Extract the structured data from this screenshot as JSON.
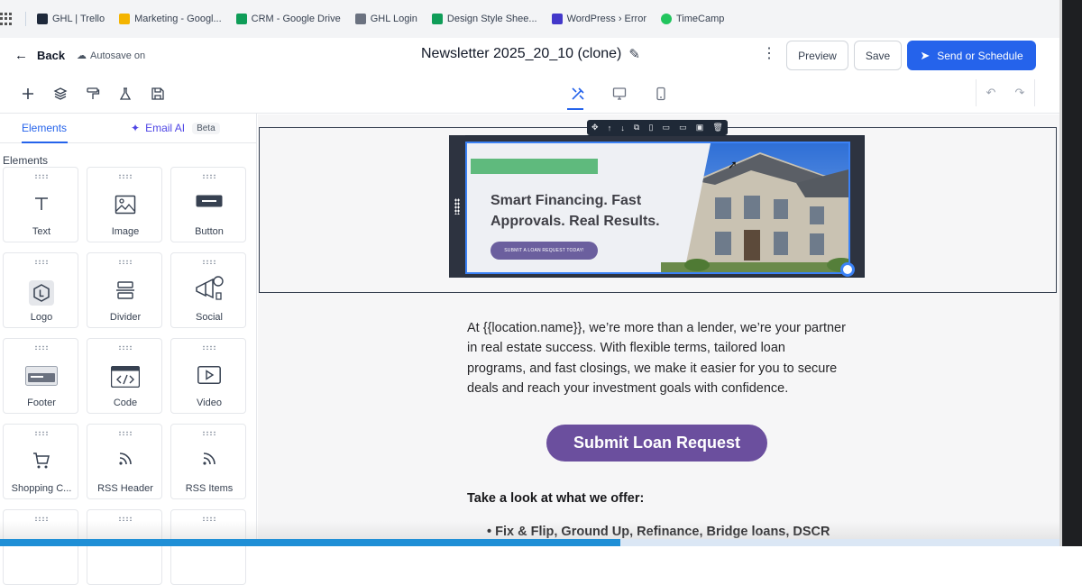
{
  "bookmarks": [
    {
      "label": "GHL | Trello",
      "color": "#1e293b"
    },
    {
      "label": "Marketing - Googl...",
      "color": "#f4b400"
    },
    {
      "label": "CRM - Google Drive",
      "color": "#0f9d58"
    },
    {
      "label": "GHL Login",
      "color": "#6b7280"
    },
    {
      "label": "Design Style Shee...",
      "color": "#0f9d58"
    },
    {
      "label": "WordPress › Error",
      "color": "#4338ca"
    },
    {
      "label": "TimeCamp",
      "color": "#22c55e"
    }
  ],
  "header": {
    "back_label": "Back",
    "autosave_label": "Autosave on",
    "title": "Newsletter 2025_20_10 (clone)",
    "preview_label": "Preview",
    "save_label": "Save",
    "send_label": "Send or Schedule"
  },
  "sidebar": {
    "tab_elements": "Elements",
    "tab_ai": "Email AI",
    "beta": "Beta",
    "section_label": "Elements",
    "tiles": [
      {
        "label": "Text",
        "icon": "T"
      },
      {
        "label": "Image",
        "icon": "▨"
      },
      {
        "label": "Button",
        "icon": "▬"
      },
      {
        "label": "Logo",
        "icon": "⬡"
      },
      {
        "label": "Divider",
        "icon": "☰"
      },
      {
        "label": "Social",
        "icon": "📣"
      },
      {
        "label": "Footer",
        "icon": "▭"
      },
      {
        "label": "Code",
        "icon": "</>"
      },
      {
        "label": "Video",
        "icon": "▷"
      },
      {
        "label": "Shopping C...",
        "icon": "🛒"
      },
      {
        "label": "RSS Header",
        "icon": "◝"
      },
      {
        "label": "RSS Items",
        "icon": "◝"
      }
    ]
  },
  "banner": {
    "headline": "Smart Financing. Fast Approvals. Real Results.",
    "cta": "SUBMIT A LOAN REQUEST TODAY!"
  },
  "content": {
    "body": "At {{location.name}}, we’re more than a lender, we’re your partner in real estate success. With flexible terms, tailored loan programs, and fast closings, we make it easier for you to secure deals and reach your investment goals with confidence.",
    "button_label": "Submit Loan Request",
    "offer_title": "Take a look at what we offer:",
    "offer_items": [
      "Fix & Flip, Ground Up, Refinance, Bridge loans, DSCR"
    ]
  },
  "colors": {
    "accent": "#2563eb",
    "button_purple": "#6b4f9e"
  }
}
